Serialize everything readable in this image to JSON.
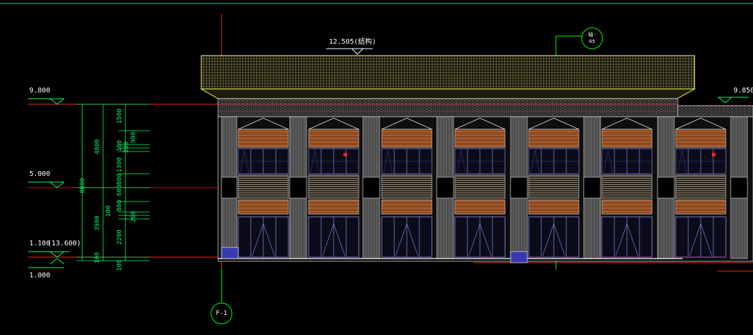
{
  "title": "",
  "levels": {
    "level_9800": "9.800",
    "level_5000": "5.000",
    "level_1100": "1.100",
    "level_1100_alt": "(13.600)",
    "level_1000": "1.000",
    "level_9850": "9.850",
    "roof_top": "12.505",
    "roof_note": "(结构)"
  },
  "dimensions": {
    "total": "8800",
    "upper": "4800",
    "lower": "3900",
    "base": "100",
    "base2": "100",
    "upper_parts": [
      "1500",
      "900",
      "200",
      "100",
      "1300",
      "800",
      "600"
    ],
    "lower_parts": [
      "800",
      "200",
      "100",
      "2200"
    ]
  },
  "axes": {
    "axis_left": "F-1",
    "axis_top_line1": "轴-",
    "axis_top_line2": "05"
  },
  "colors": {
    "background": "#000000",
    "roof": "#ffff66",
    "timber": "#a0522d",
    "glazing": "#6a6ab0",
    "level_line": "#ff0000",
    "axis_line": "#00ff00",
    "dimension": "#00ff66"
  }
}
